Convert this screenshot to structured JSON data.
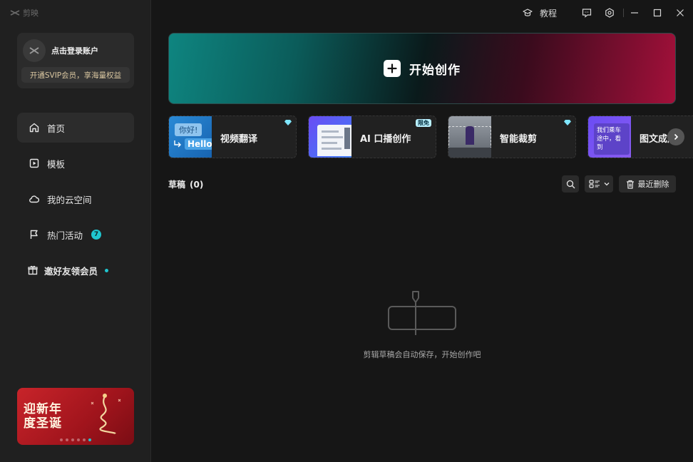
{
  "app": {
    "title": "剪映"
  },
  "titlebar": {
    "tutorial": "教程"
  },
  "account": {
    "login": "点击登录账户",
    "vip": "开通SVIP会员，享海量权益"
  },
  "nav": [
    {
      "label": "首页",
      "icon": "home-icon",
      "active": true
    },
    {
      "label": "模板",
      "icon": "template-icon"
    },
    {
      "label": "我的云空间",
      "icon": "cloud-icon"
    },
    {
      "label": "热门活动",
      "icon": "flag-icon",
      "badge": "7"
    },
    {
      "label": "邀好友领会员",
      "icon": "gift-icon",
      "dot": true
    }
  ],
  "promo": {
    "text": "迎新年\n度圣诞",
    "pages": 6,
    "active_page": 5
  },
  "create": {
    "label": "开始创作"
  },
  "tools": [
    {
      "label": "视频翻译",
      "thumb_text_1": "你好!",
      "thumb_text_2": "Hello",
      "mark": "diamond-icon"
    },
    {
      "label": "AI 口播创作",
      "tag": "限免"
    },
    {
      "label": "智能裁剪",
      "mark": "diamond-icon"
    },
    {
      "label": "图文成片",
      "thumb_text": "我们乘车途中，看到"
    }
  ],
  "drafts": {
    "title": "草稿",
    "count": "(0)",
    "recent_delete": "最近删除",
    "empty_text": "剪辑草稿会自动保存，开始创作吧"
  },
  "colors": {
    "accent": "#1fc6cf",
    "banner_left": "#0e8580",
    "banner_right": "#a3103a",
    "vip_text": "#d9c6a0"
  }
}
